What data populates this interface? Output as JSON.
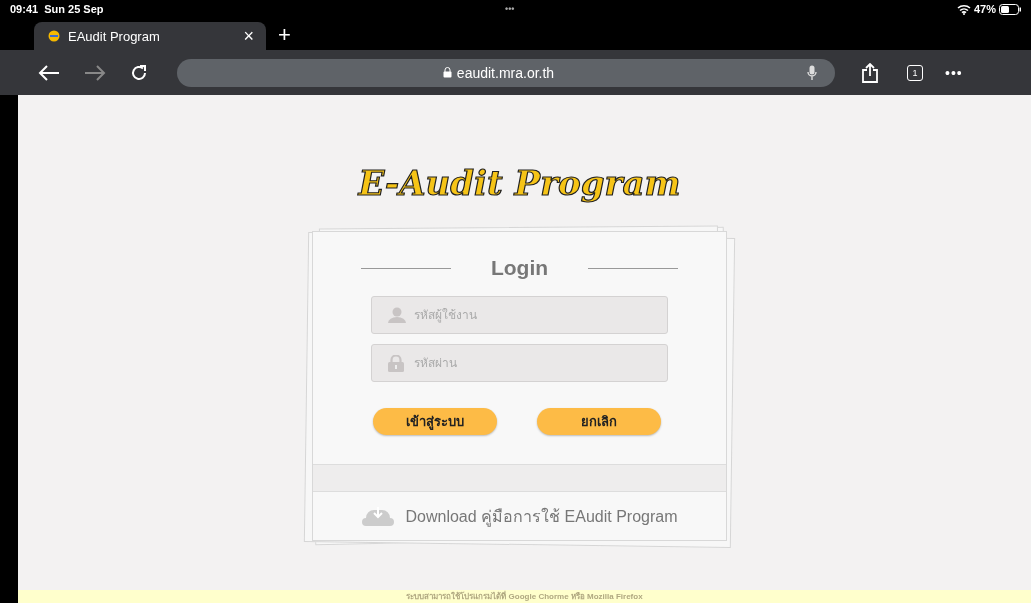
{
  "status_bar": {
    "time": "09:41",
    "date": "Sun 25 Sep",
    "dots": "•••",
    "battery": "47%"
  },
  "tabs": [
    {
      "title": "EAudit Program",
      "selected": true,
      "close": "×"
    }
  ],
  "new_tab": "+",
  "toolbar": {
    "url": "eaudit.mra.or.th",
    "tab_count": "1",
    "more": "•••"
  },
  "logo": "E-Audit Program",
  "login": {
    "title": "Login",
    "fields": [
      {
        "kind": "user",
        "placeholder": "รหัสผู้ใช้งาน"
      },
      {
        "kind": "password",
        "placeholder": "รหัสผ่าน"
      }
    ],
    "buttons": [
      "เข้าสู่ระบบ",
      "ยกเลิก"
    ],
    "download": "Download คู่มือการใช้ EAudit Program"
  },
  "footer": "ระบบสามารถใช้โปรแกรมได้ที่ Google Chorme หรือ Mozilla Firefox"
}
